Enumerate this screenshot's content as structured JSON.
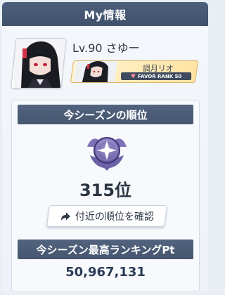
{
  "header": {
    "title": "My情報"
  },
  "profile": {
    "player_name": "Lv.90 さゆー",
    "student": {
      "name": "調月リオ",
      "favor_label": "FAVOR RANK 50"
    }
  },
  "ranking": {
    "season_title": "今シーズンの順位",
    "rank": "315位",
    "nearby_button": "付近の順位を確認",
    "best_title": "今シーズン最高ランキングPt",
    "best_points": "50,967,131"
  }
}
